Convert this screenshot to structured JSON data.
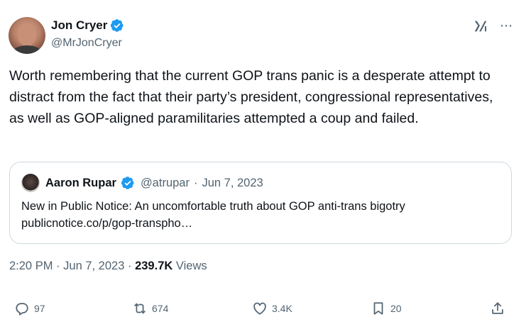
{
  "author": {
    "display_name": "Jon Cryer",
    "handle": "@MrJonCryer",
    "verified": true
  },
  "tweet": {
    "text": "Worth remembering that the current GOP trans panic is a desperate attempt to distract from the fact that their party’s president, congressional representatives, as well as GOP-aligned paramilitaries attempted a coup and failed."
  },
  "quoted_tweet": {
    "display_name": "Aaron Rupar",
    "handle": "@atrupar",
    "separator": "·",
    "date": "Jun 7, 2023",
    "text_line1": "New in Public Notice: An uncomfortable truth about GOP anti-trans bigotry",
    "text_line2": "publicnotice.co/p/gop-transpho…"
  },
  "meta": {
    "time": "2:20 PM",
    "separator": "·",
    "date": "Jun 7, 2023",
    "views_count": "239.7K",
    "views_label": "Views"
  },
  "actions": {
    "replies": "97",
    "reposts": "674",
    "likes": "3.4K",
    "bookmarks": "20"
  },
  "colors": {
    "verified_blue": "#1d9bf0",
    "secondary_text": "#536471",
    "primary_text": "#0f1419",
    "border": "#cfd9de"
  },
  "icons": [
    "verified-badge-icon",
    "grok-icon",
    "more-icon",
    "reply-icon",
    "repost-icon",
    "like-icon",
    "bookmark-icon",
    "share-icon"
  ]
}
